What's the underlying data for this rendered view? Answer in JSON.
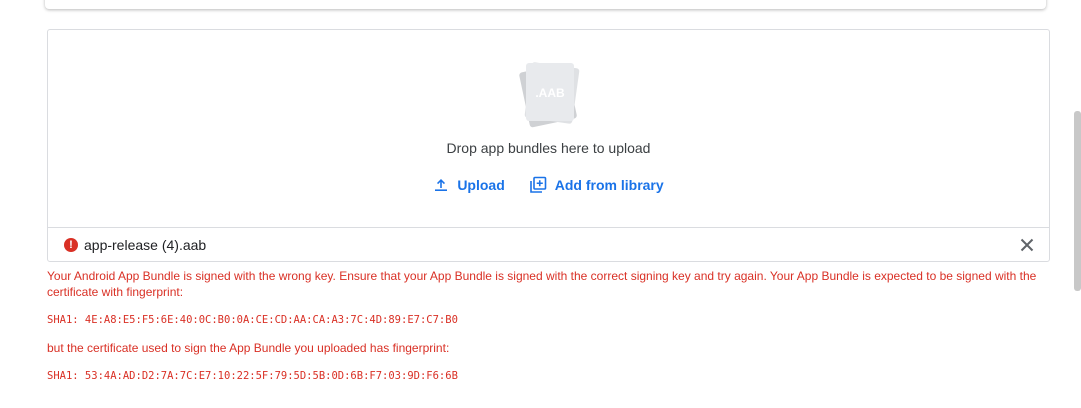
{
  "upload": {
    "file_type_badge": ".AAB",
    "drop_text": "Drop app bundles here to upload",
    "upload_label": "Upload",
    "library_label": "Add from library"
  },
  "file": {
    "name": "app-release (4).aab",
    "status": "error",
    "status_icon": "error-icon",
    "status_color": "#d93025"
  },
  "error": {
    "message": "Your Android App Bundle is signed with the wrong key. Ensure that your App Bundle is signed with the correct signing key and try again. Your App Bundle is expected to be signed with the certificate with fingerprint:",
    "expected_fingerprint": "SHA1: 4E:A8:E5:F5:6E:40:0C:B0:0A:CE:CD:AA:CA:A3:7C:4D:89:E7:C7:B0",
    "uploaded_intro": "but the certificate used to sign the App Bundle you uploaded has fingerprint:",
    "uploaded_fingerprint": "SHA1: 53:4A:AD:D2:7A:7C:E7:10:22:5F:79:5D:5B:0D:6B:F7:03:9D:F6:6B"
  },
  "colors": {
    "accent": "#1a73e8",
    "error": "#d93025",
    "border": "#dadce0"
  }
}
